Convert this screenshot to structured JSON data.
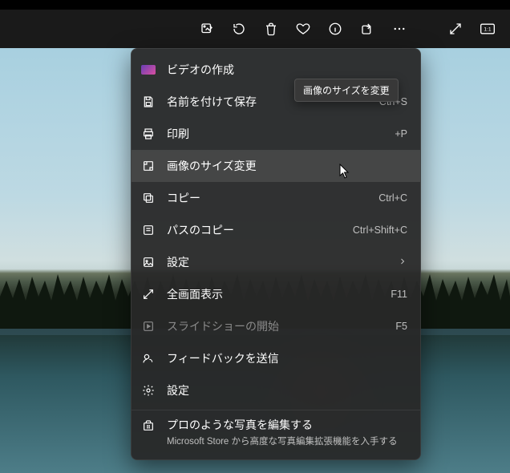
{
  "toolbar": {
    "edit": "edit",
    "rotate": "rotate",
    "delete": "delete",
    "favorite": "favorite",
    "info": "info",
    "share": "share",
    "more": "more",
    "fullscreen": "fullscreen",
    "actualsize": "actualsize"
  },
  "tooltip": "画像のサイズを変更",
  "menu": {
    "create_video": "ビデオの作成",
    "save_as": {
      "label": "名前を付けて保存",
      "shortcut": "Ctrl+S"
    },
    "print": {
      "label": "印刷",
      "shortcut": "+P"
    },
    "resize": {
      "label": "画像のサイズ変更"
    },
    "copy": {
      "label": "コピー",
      "shortcut": "Ctrl+C"
    },
    "copy_path": {
      "label": "パスのコピー",
      "shortcut": "Ctrl+Shift+C"
    },
    "set_as": {
      "label": "設定"
    },
    "fullscreen": {
      "label": "全画面表示",
      "shortcut": "F11"
    },
    "slideshow": {
      "label": "スライドショーの開始",
      "shortcut": "F5"
    },
    "feedback": {
      "label": "フィードバックを送信"
    },
    "settings": {
      "label": "設定"
    },
    "promo": {
      "label": "プロのような写真を編集する",
      "sub": "Microsoft Store から高度な写真編集拡張機能を入手する"
    }
  }
}
